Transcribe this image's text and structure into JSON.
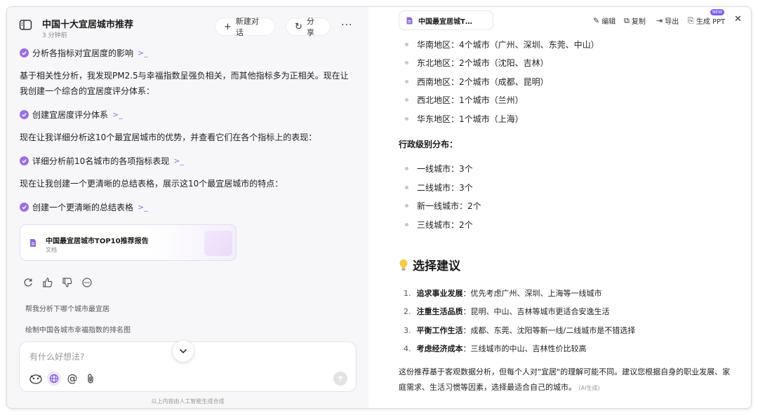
{
  "left": {
    "title": "中国十大宜居城市推荐",
    "time": "3 分钟前",
    "new_chat": "新建对话",
    "share": "分享",
    "more": "···",
    "steps": [
      "分析各指标对宜居度的影响",
      "创建宜居度评分体系",
      "详细分析前10名城市的各项指标表现",
      "创建一个更清晰的总结表格"
    ],
    "paras": [
      "基于相关性分析，我发现PM2.5与幸福指数呈强负相关，而其他指标多为正相关。现在让我创建一个综合的宜居度评分体系：",
      "现在让我详细分析这10个最宜居城市的优势，并查看它们在各个指标上的表现：",
      "现在让我创建一个更清晰的总结表格，展示这10个最宜居城市的特点："
    ],
    "doc_card": {
      "title": "中国最宜居城市TOP10推荐报告",
      "type": "文档"
    },
    "suggestions": [
      "帮我分析下哪个城市最宜居",
      "绘制中国各城市幸福指数的排名图"
    ],
    "input_placeholder": "有什么好想法?",
    "footer": "以上内容由人工智能生成合成"
  },
  "right": {
    "tab_title": "中国最宜居城T…",
    "toolbar": {
      "edit": "编辑",
      "copy": "复制",
      "export": "导出",
      "ppt": "生成 PPT",
      "new_badge": "NEW"
    },
    "region_items": [
      "华南地区：4个城市（广州、深圳、东莞、中山）",
      "东北地区：2个城市（沈阳、吉林）",
      "西南地区：2个城市（成都、昆明）",
      "西北地区：1个城市（兰州）",
      "华东地区：1个城市（上海）"
    ],
    "admin_heading": "行政级别分布：",
    "admin_items": [
      "一线城市：3个",
      "二线城市：3个",
      "新一线城市：2个",
      "三线城市：2个"
    ],
    "section_title": "选择建议",
    "suggestions": [
      {
        "n": "1.",
        "bold": "追求事业发展",
        "text": "：优先考虑广州、深圳、上海等一线城市"
      },
      {
        "n": "2.",
        "bold": "注重生活品质",
        "text": "：昆明、中山、吉林等城市更适合安逸生活"
      },
      {
        "n": "3.",
        "bold": "平衡工作生活",
        "text": "：成都、东莞、沈阳等新一线/二线城市是不错选择"
      },
      {
        "n": "4.",
        "bold": "考虑经济成本",
        "text": "：三线城市的中山、吉林性价比较高"
      }
    ],
    "closing": "这份推荐基于客观数据分析，但每个人对\"宜居\"的理解可能不同。建议您根据自身的职业发展、家庭需求、生活习惯等因素，选择最适合自己的城市。",
    "ai_tag": "(AI生成)"
  },
  "colors": {
    "accent": "#9b6ee8",
    "panel_bg": "#f7f7f9"
  }
}
